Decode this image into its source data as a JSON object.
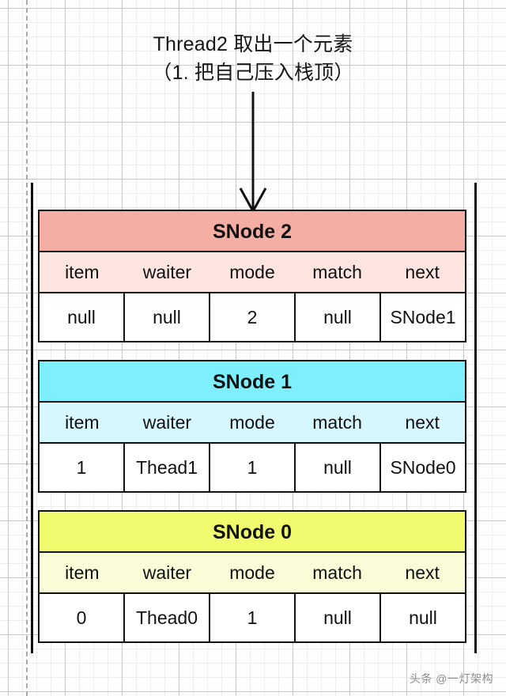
{
  "caption": {
    "line1": "Thread2 取出一个元素",
    "line2": "（1. 把自己压入栈顶）",
    "text": "Thread2 取出一个元素\n（1. 把自己压入栈顶）"
  },
  "colors": {
    "salmon_title": "#f4aea4",
    "salmon_header": "#fce4df",
    "cyan_title": "#7eeffc",
    "cyan_header": "#d7f7fe",
    "yellow_title": "#f0fb6e",
    "yellow_header": "#fafcd8",
    "border": "#111111",
    "grid_minor": "#ededed",
    "grid_major": "#c9c9c9",
    "guide_dashed": "#a9a9a9"
  },
  "field_headers": [
    "item",
    "waiter",
    "mode",
    "match",
    "next"
  ],
  "nodes": [
    {
      "title": "SNode 2",
      "theme": "theme-salmon",
      "fields": [
        "item",
        "waiter",
        "mode",
        "match",
        "next"
      ],
      "values": [
        "null",
        "null",
        "2",
        "null",
        "SNode1"
      ]
    },
    {
      "title": "SNode 1",
      "theme": "theme-cyan",
      "fields": [
        "item",
        "waiter",
        "mode",
        "match",
        "next"
      ],
      "values": [
        "1",
        "Thead1",
        "1",
        "null",
        "SNode0"
      ]
    },
    {
      "title": "SNode 0",
      "theme": "theme-yellow",
      "fields": [
        "item",
        "waiter",
        "mode",
        "match",
        "next"
      ],
      "values": [
        "0",
        "Thead0",
        "1",
        "null",
        "null"
      ]
    }
  ],
  "watermark": "头条 @一灯架构"
}
